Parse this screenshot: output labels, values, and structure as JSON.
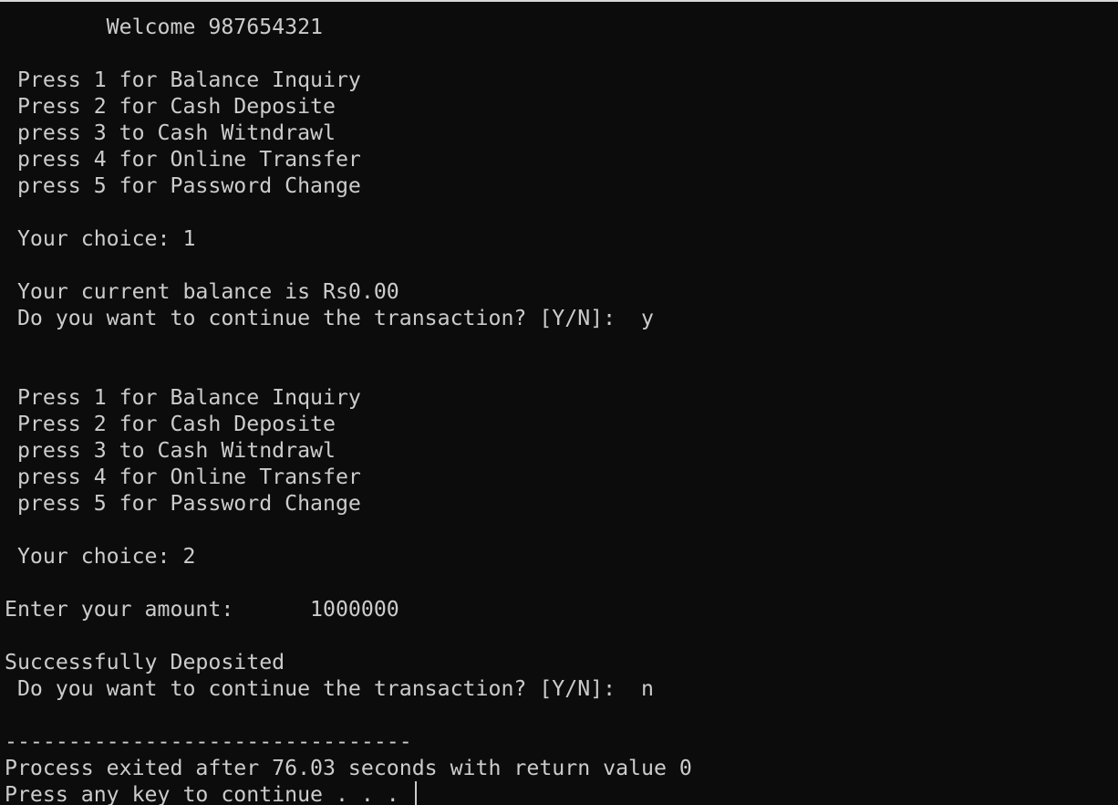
{
  "console": {
    "lines": [
      "        Welcome 987654321",
      "",
      " Press 1 for Balance Inquiry",
      " Press 2 for Cash Deposite",
      " press 3 to Cash Witndrawl",
      " press 4 for Online Transfer",
      " press 5 for Password Change",
      "",
      " Your choice: 1",
      "",
      " Your current balance is Rs0.00",
      " Do you want to continue the transaction? [Y/N]:  y",
      "",
      "",
      " Press 1 for Balance Inquiry",
      " Press 2 for Cash Deposite",
      " press 3 to Cash Witndrawl",
      " press 4 for Online Transfer",
      " press 5 for Password Change",
      "",
      " Your choice: 2",
      "",
      "Enter your amount:      1000000",
      "",
      "Successfully Deposited",
      " Do you want to continue the transaction? [Y/N]:  n",
      "",
      "--------------------------------",
      "Process exited after 76.03 seconds with return value 0",
      "Press any key to continue . . . "
    ]
  }
}
